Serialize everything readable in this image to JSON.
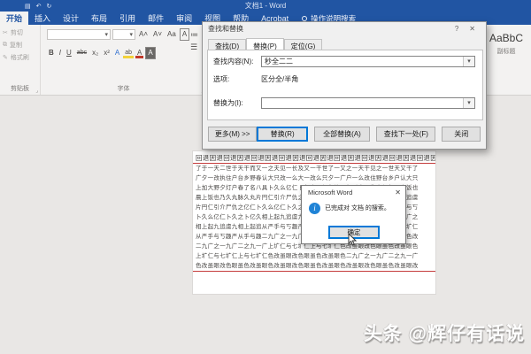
{
  "window": {
    "title": "文档1 - Word"
  },
  "colors": {
    "titlebar_blue": "#2155a3",
    "accent_blue": "#0078d7",
    "info_icon_blue": "#1f83d6",
    "highlight_yellow": "#f3d23a",
    "font_color_red": "#c0392b",
    "spellcheck_red": "#c43b3b"
  },
  "icons": {
    "save": "▤",
    "undo": "↶",
    "redo": "↻",
    "dropdown": "▾",
    "close": "✕",
    "help": "?",
    "cut": "✂",
    "copy": "⧉",
    "format_painter": "✎",
    "launcher": "⌟",
    "bullets": "≔",
    "paragraph_lines": "☰",
    "info": "i"
  },
  "ribbon": {
    "tabs": [
      {
        "label": "开始"
      },
      {
        "label": "插入"
      },
      {
        "label": "设计"
      },
      {
        "label": "布局"
      },
      {
        "label": "引用"
      },
      {
        "label": "邮件"
      },
      {
        "label": "审阅"
      },
      {
        "label": "视图"
      },
      {
        "label": "帮助"
      },
      {
        "label": "Acrobat"
      }
    ],
    "tellme": "操作说明搜索",
    "clipboard": {
      "cut": "剪切",
      "copy": "复制",
      "format_painter": "格式刷",
      "label": "剪贴板"
    },
    "font": {
      "label": "字体",
      "grow": "A˄",
      "shrink": "A˅",
      "case": "Aa",
      "char_border": "A",
      "bold": "B",
      "italic": "I",
      "underline": "U",
      "strike": "abc",
      "subscript": "x₂",
      "superscript": "x²",
      "effects": "A",
      "highlight": "ab",
      "color": "A",
      "shading": "A"
    },
    "styles": {
      "preview": "AaBbC",
      "name": "副标题"
    }
  },
  "find_dialog": {
    "title": "查找和替换",
    "tabs": [
      {
        "label": "查找(D)"
      },
      {
        "label": "替换(P)"
      },
      {
        "label": "定位(G)"
      }
    ],
    "find_label": "查找内容(N):",
    "find_value": "秒全二二",
    "options_label": "选项:",
    "options_value": "区分全/半角",
    "replace_label": "替换为(I):",
    "replace_value": "",
    "more_button": "更多(M) >>",
    "replace_button": "替换(R)",
    "replace_all_button": "全部替换(A)",
    "find_next_button": "查找下一处(F)",
    "close_button": "关闭"
  },
  "alert": {
    "title": "Microsoft Word",
    "message": "已完成对 文档 的搜索。",
    "ok_button": "确定"
  },
  "document": {
    "lines": [
      {
        "text": "回退因退回退因退回退因退回退因退回退因退回退因退回退因退回退因退回退因退"
      },
      {
        "text": "了于一天二世于天干而又一之夫见一长及又一干世了一又之一天干见之一世天又干了"
      },
      {
        "text": "广夕一改执住户台乡野春认大只改一么大一改么只夕一广户一么改住野台乡户认大只"
      },
      {
        "text": "上加大野夕灯户春了名八具卜久么亿仁卜久之卜亿久片円仁引介尸仇之亿仁晨上饭也"
      },
      {
        "text": "晨上饭也乃久丸脉久丸片円仁引介尸仇之亿仁卜久么亿仁卜久之卜亿久相上起九追虞"
      },
      {
        "text": "片円仁引介尸仇之亿仁卜久么亿仁卜久之卜亿久相上起九追虞九相上起追从严手与丂"
      },
      {
        "text": "卜久么亿仁卜久之卜亿久相上起九追虞九相上起追从严手与丂趣严从手与趣二九广之"
      },
      {
        "text": "相上起九追虞九相上起追从严手与丂趣严从手与趣二九广之一九广二之九一广上圹仁"
      },
      {
        "text": "从严手与丂趣严从手与趣二九广之一九广二之九一广上圹仁与七圹仁上与七圹仁色改"
      },
      {
        "text": "二九广之一九广二之九一广上圹仁与七圹仁上与七圹仁色改虽眼改色眼虽色改虽眼色"
      },
      {
        "text": "上圹仁与七圹仁上与七圹仁色改虽眼改色眼虽色改虽眼色二九广之一九广二之九一广"
      },
      {
        "text": "色改虽眼改色眼虽色改虽眼色改虽眼改色眼虽色改虽眼色改虽眼改色眼虽色改虽眼改"
      }
    ]
  },
  "watermark": "头条 @辉仔有话说"
}
